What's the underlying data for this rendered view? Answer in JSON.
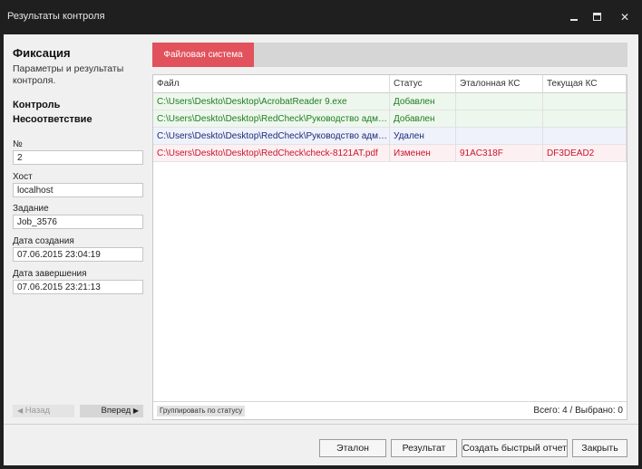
{
  "window": {
    "title": "Результаты контроля"
  },
  "sidebar": {
    "heading": "Фиксация",
    "description": "Параметры и результаты контроля.",
    "nav": [
      "Контроль",
      "Несоответствие"
    ],
    "fields": [
      {
        "label": "№",
        "value": "2"
      },
      {
        "label": "Хост",
        "value": "localhost"
      },
      {
        "label": "Задание",
        "value": "Job_3576"
      },
      {
        "label": "Дата создания",
        "value": "07.06.2015 23:04:19"
      },
      {
        "label": "Дата завершения",
        "value": "07.06.2015 23:21:13"
      }
    ],
    "prev_label": "Назад",
    "next_label": "Вперед"
  },
  "tabs": {
    "active": "Файловая система"
  },
  "table": {
    "columns": [
      "Файл",
      "Статус",
      "Эталонная КС",
      "Текущая КС"
    ],
    "rows": [
      {
        "file": "C:\\Users\\Deskto\\Desktop\\AcrobatReader 9.exe",
        "status": "Добавлен",
        "ref": "",
        "cur": "",
        "kind": "added"
      },
      {
        "file": "C:\\Users\\Deskto\\Desktop\\RedCheck\\Руководство администратора",
        "status": "Добавлен",
        "ref": "",
        "cur": "",
        "kind": "added"
      },
      {
        "file": "C:\\Users\\Deskto\\Desktop\\RedCheck\\Руководство администратора",
        "status": "Удален",
        "ref": "",
        "cur": "",
        "kind": "deleted"
      },
      {
        "file": "C:\\Users\\Deskto\\Desktop\\RedCheck\\check-8121AT.pdf",
        "status": "Изменен",
        "ref": "91AC318F",
        "cur": "DF3DEAD2",
        "kind": "changed"
      }
    ],
    "group_button": "Группировать по статусу",
    "counter": "Всего: 4 / Выбрано: 0"
  },
  "buttons": {
    "etalon": "Эталон",
    "result": "Результат",
    "quick_report": "Создать быстрый отчет",
    "close": "Закрыть"
  },
  "colors": {
    "accent": "#e2525c",
    "added": "#1e7d1e",
    "deleted": "#1b2a7a",
    "changed": "#c8152b"
  }
}
